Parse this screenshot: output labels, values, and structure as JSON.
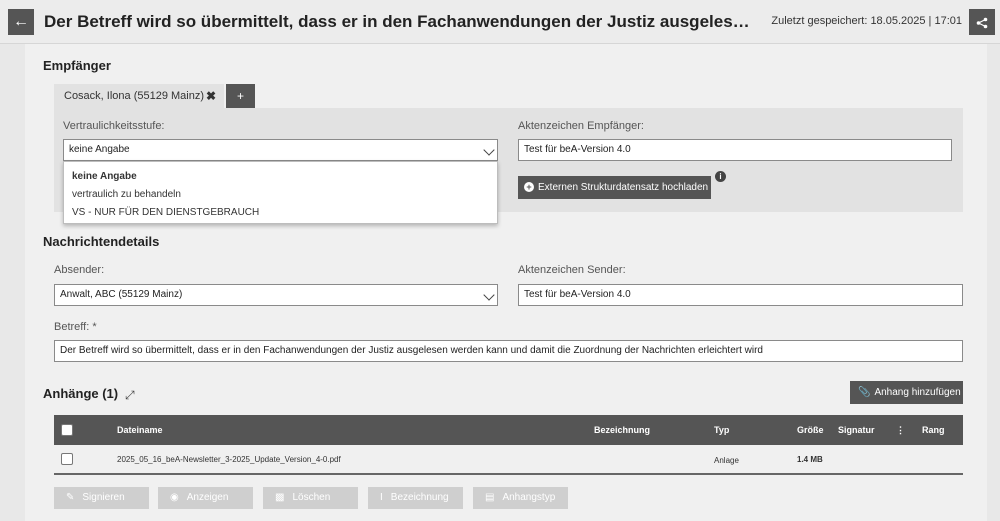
{
  "header": {
    "title": "Der Betreff wird so übermittelt, dass er in den Fachanwendungen der Justiz ausgelesen werden kann und damit die Zuordnung der Nachrichten erleichtert wird",
    "saved": "Zuletzt gespeichert: 18.05.2025 | 17:01"
  },
  "recipients": {
    "section_title": "Empfänger",
    "tab_label": "Cosack, Ilona (55129 Mainz)",
    "add_label": "+",
    "confidentiality_label": "Vertraulichkeitsstufe:",
    "confidentiality_value": "keine Angabe",
    "confidentiality_options": [
      "keine Angabe",
      "vertraulich zu behandeln",
      "VS - NUR FÜR DEN DIENSTGEBRAUCH"
    ],
    "file_ref_label": "Aktenzeichen Empfänger:",
    "file_ref_value": "Test für beA-Version 4.0",
    "upload_button": "Externen Strukturdatensatz hochladen"
  },
  "details": {
    "section_title": "Nachrichtendetails",
    "sender_label": "Absender:",
    "sender_value": "Anwalt, ABC (55129 Mainz)",
    "sender_ref_label": "Aktenzeichen Sender:",
    "sender_ref_value": "Test für beA-Version 4.0",
    "subject_label": "Betreff: *",
    "subject_value": "Der Betreff wird so übermittelt, dass er in den Fachanwendungen der Justiz ausgelesen werden kann und damit die Zuordnung der Nachrichten erleichtert wird"
  },
  "attachments": {
    "section_title": "Anhänge (1)",
    "add_button": "Anhang hinzufügen",
    "columns": {
      "filename": "Dateiname",
      "label": "Bezeichnung",
      "type": "Typ",
      "size": "Größe",
      "signature": "Signatur",
      "more": "⋮",
      "rank": "Rang"
    },
    "rows": [
      {
        "filename": "2025_05_16_beA-Newsletter_3-2025_Update_Version_4-0.pdf",
        "label": "",
        "type": "Anlage",
        "size": "1.4 MB",
        "signature": "",
        "rank": ""
      }
    ],
    "actions": {
      "sign": "Signieren",
      "show": "Anzeigen",
      "delete": "Löschen",
      "rename": "Bezeichnung",
      "type": "Anhangstyp"
    }
  },
  "icons": {
    "back": "arrow-left-icon",
    "share": "share-icon",
    "remove": "close-icon",
    "expand": "expand-icon",
    "info": "info-icon",
    "attach": "paperclip-icon"
  }
}
